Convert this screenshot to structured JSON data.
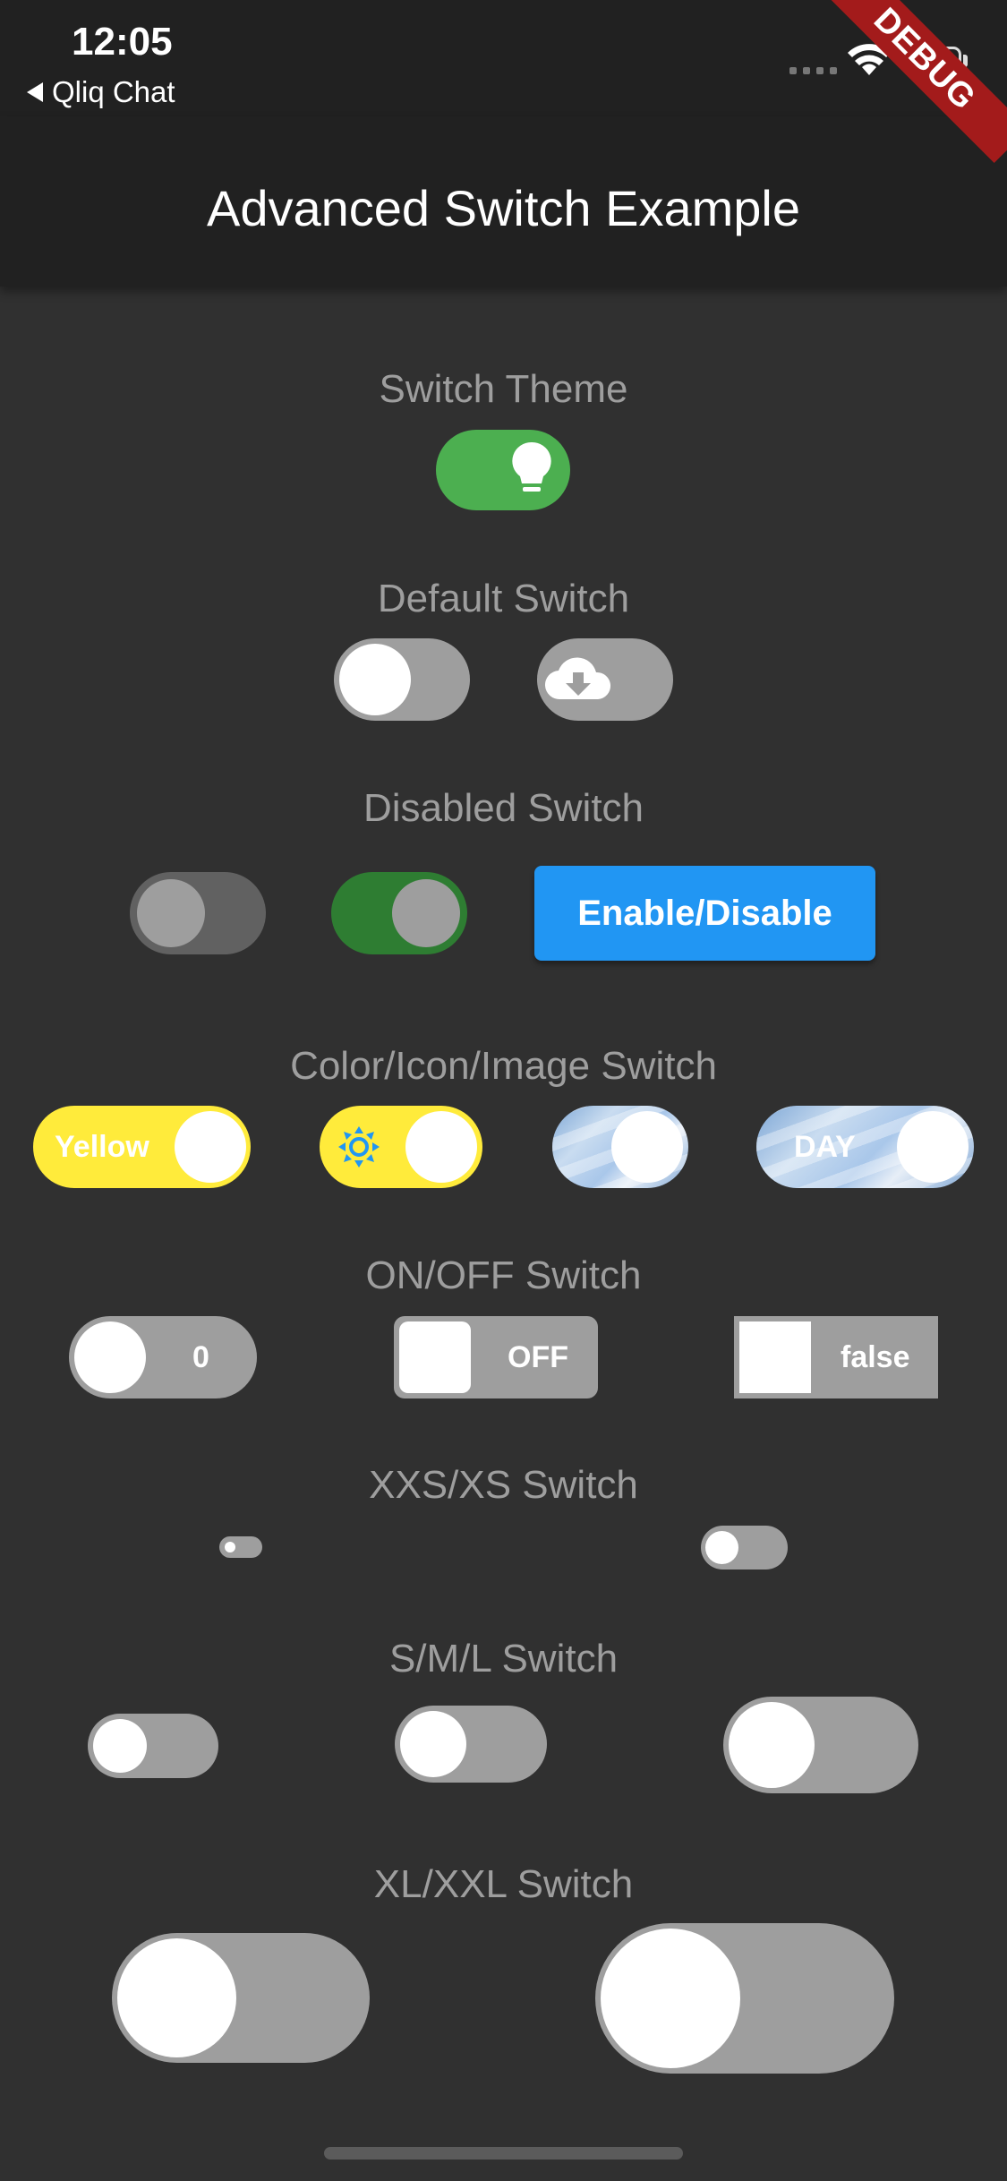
{
  "status_bar": {
    "time": "12:05",
    "back_app": "Qliq Chat"
  },
  "debug_banner": "DEBUG",
  "app_bar": {
    "title": "Advanced Switch Example"
  },
  "sections": {
    "switch_theme": "Switch Theme",
    "default_switch": "Default Switch",
    "disabled_switch": "Disabled Switch",
    "color_icon_image_switch": "Color/Icon/Image Switch",
    "on_off_switch": "ON/OFF Switch",
    "xxs_xs_switch": "XXS/XS Switch",
    "sml_switch": "S/M/L Switch",
    "xl_xxl_switch": "XL/XXL Switch"
  },
  "buttons": {
    "enable_disable": "Enable/Disable"
  },
  "switch_labels": {
    "yellow": "Yellow",
    "day": "DAY",
    "zero": "0",
    "off": "OFF",
    "false": "false"
  },
  "icons": {
    "theme": "lightbulb-icon",
    "default": "cloud-download-icon",
    "sun": "sun-icon",
    "wifi": "wifi-icon",
    "battery": "battery-icon",
    "back": "back-arrow-icon"
  },
  "colors": {
    "background": "#303030",
    "appbar": "#212121",
    "accent_green": "#4caf50",
    "track_grey": "#9e9e9e",
    "button_blue": "#2196f3",
    "yellow": "#ffeb3b",
    "debug_red": "#a31b1b"
  }
}
